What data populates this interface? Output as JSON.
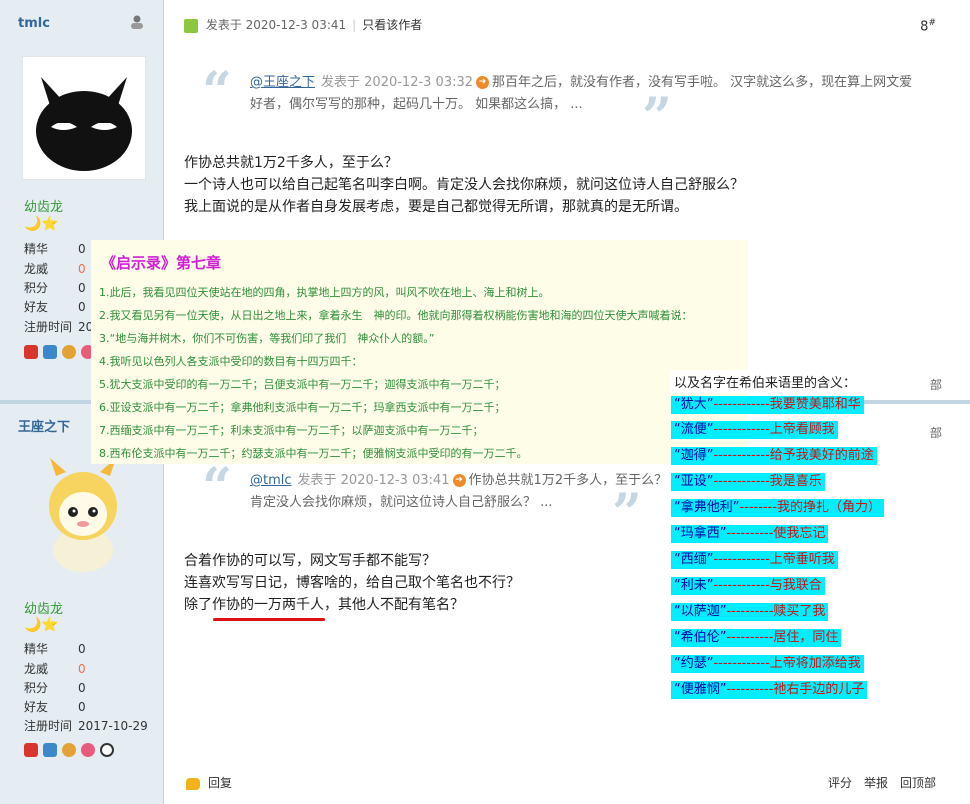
{
  "posts": [
    {
      "user": {
        "name": "tmlc",
        "group": "幼齿龙",
        "stars": "🌙⭐",
        "stats": [
          {
            "k": "精华",
            "v": "0"
          },
          {
            "k": "龙威",
            "v": "0"
          },
          {
            "k": "积分",
            "v": "0"
          },
          {
            "k": "好友",
            "v": "0"
          },
          {
            "k": "注册时间",
            "v": "20"
          }
        ]
      },
      "header": {
        "prefix": "发表于 2020-12-3 03:41",
        "author_only": "只看该作者",
        "floor": "8",
        "floor_mark": "#"
      },
      "quote": {
        "author": "@王座之下",
        "meta": "发表于 2020-12-3 03:32",
        "line1": "那百年之后，就没有作者，没有写手啦。 汉字就这么多，现在算上网文爱",
        "line2": "好者，偶尔写写的那种，起码几十万。 如果都这么搞， ..."
      },
      "body": [
        "作协总共就1万2千多人，至于么？",
        "一个诗人也可以给自己起笔名叫李白啊。肯定没人会找你麻烦，就问这位诗人自己舒服么？",
        "我上面说的是从作者自身发展考虑，要是自己都觉得无所谓，那就真的是无所谓。"
      ]
    },
    {
      "user": {
        "name": "王座之下",
        "group": "幼齿龙",
        "stars": "🌙⭐",
        "stats": [
          {
            "k": "精华",
            "v": "0"
          },
          {
            "k": "龙威",
            "v": "0"
          },
          {
            "k": "积分",
            "v": "0"
          },
          {
            "k": "好友",
            "v": "0"
          },
          {
            "k": "注册时间",
            "v": "2017-10-29"
          }
        ]
      },
      "quote": {
        "author": "@tmlc",
        "meta": "发表于 2020-12-3 03:41",
        "line1": "作协总共就1万2千多人，至于么？",
        "line2": "肯定没人会找你麻烦，就问这位诗人自己舒服么？ ..."
      },
      "body": [
        "合着作协的可以写，网文写手都不能写？",
        "连喜欢写写日记，博客啥的，给自己取个笔名也不行？",
        "除了作协的一万两千人，其他人不配有笔名？"
      ],
      "footer": {
        "reply": "回复",
        "links": [
          "评分",
          "举报",
          "回顶部"
        ]
      }
    }
  ],
  "overlay": {
    "title": "《启示录》第七章",
    "verses": [
      "1.此后，我看见四位天使站在地的四角，执掌地上四方的风，叫风不吹在地上、海上和树上。",
      "2.我又看见另有一位天使，从日出之地上来，拿着永生　神的印。他就向那得着权柄能伤害地和海的四位天使大声喊着说：",
      "3.“地与海并树木，你们不可伤害，等我们印了我们　神众仆人的额。”",
      "4.我听见以色列人各支派中受印的数目有十四万四千：",
      "5.犹大支派中受印的有一万二千；吕便支派中有一万二千；迦得支派中有一万二千；",
      "6.亚设支派中有一万二千；拿弗他利支派中有一万二千；玛拿西支派中有一万二千；",
      "7.西缅支派中有一万二千；利未支派中有一万二千；以萨迦支派中有一万二千；",
      "8.西布伦支派中有一万二千；约瑟支派中有一万二千；便雅悯支派中受印的有一万二千。"
    ]
  },
  "names": {
    "title": "以及名字在希伯来语里的含义：",
    "rows": [
      {
        "name": "“犹大”",
        "dash": "------------",
        "meaning": "我要赞美耶和华"
      },
      {
        "name": "“流便”",
        "dash": "------------",
        "meaning": "上帝看顾我"
      },
      {
        "name": "“迦得”",
        "dash": "------------",
        "meaning": "给予我美好的前途"
      },
      {
        "name": "“亚设”",
        "dash": "------------",
        "meaning": "我是喜乐"
      },
      {
        "name": "“拿弗他利”",
        "dash": "--------",
        "meaning": "我的挣扎（角力）"
      },
      {
        "name": "“玛拿西”",
        "dash": "----------",
        "meaning": "使我忘记"
      },
      {
        "name": "“西缅”",
        "dash": "------------",
        "meaning": "上帝垂听我"
      },
      {
        "name": "“利未”",
        "dash": "------------",
        "meaning": "与我联合"
      },
      {
        "name": "“以萨迦”",
        "dash": "----------",
        "meaning": "赎买了我"
      },
      {
        "name": "“希伯伦”",
        "dash": "----------",
        "meaning": "居住，同住"
      },
      {
        "name": "“约瑟”",
        "dash": "------------",
        "meaning": "上帝将加添给我"
      },
      {
        "name": "“便雅悯”",
        "dash": "----------",
        "meaning": "祂右手边的儿子"
      }
    ]
  },
  "side_tags": [
    "部",
    "部"
  ]
}
